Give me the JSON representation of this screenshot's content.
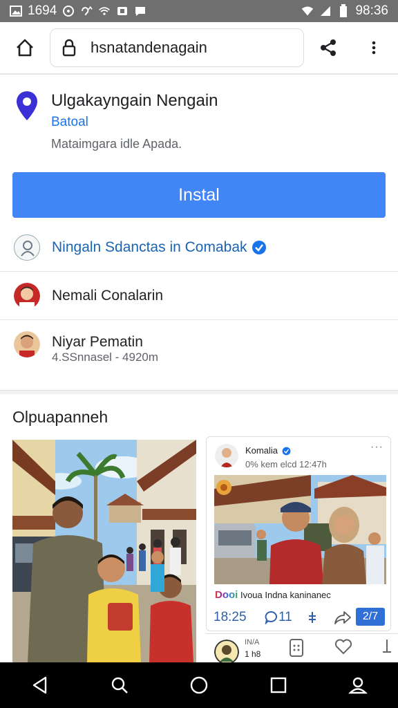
{
  "status_bar": {
    "left_text": "1694",
    "time": "98:36",
    "icons_left": [
      "image-icon",
      "sync-icon",
      "vpn-icon",
      "wifi-icon",
      "camera-icon",
      "chat-icon"
    ],
    "icons_right": [
      "wifi-full-icon",
      "signal-icon",
      "battery-icon"
    ]
  },
  "browser": {
    "url": "hsnatandenagain",
    "home_icon": "home-icon",
    "lock_icon": "lock-icon",
    "share_icon": "share-icon",
    "menu_icon": "more-vert-icon"
  },
  "place": {
    "title": "Ulgakayngain Nengain",
    "subtitle": "Batoal",
    "description": "Mataimgara idle Apada.",
    "install_label": "Instal",
    "accent_color": "#4285f4",
    "pin_color": "#3b2fd6"
  },
  "rows": [
    {
      "label": "Ningaln Sdanctas in Comabak",
      "verified": true
    },
    {
      "label": "Nemali Conalarin"
    },
    {
      "label": "Niyar Pematin",
      "sub": "4.SSnnasel - 4920m"
    }
  ],
  "section": {
    "title": "Olpuapanneh"
  },
  "post": {
    "author": "Komalia",
    "meta": "0% kem elcd 12:47h",
    "more": "···",
    "caption_brand": "Dooi",
    "caption_text": "Ivoua Indna kaninanec",
    "time": "18:25",
    "comments": "11",
    "share_badge": "2/7"
  },
  "post2": {
    "name": "IN/A",
    "count": "1 h8"
  }
}
